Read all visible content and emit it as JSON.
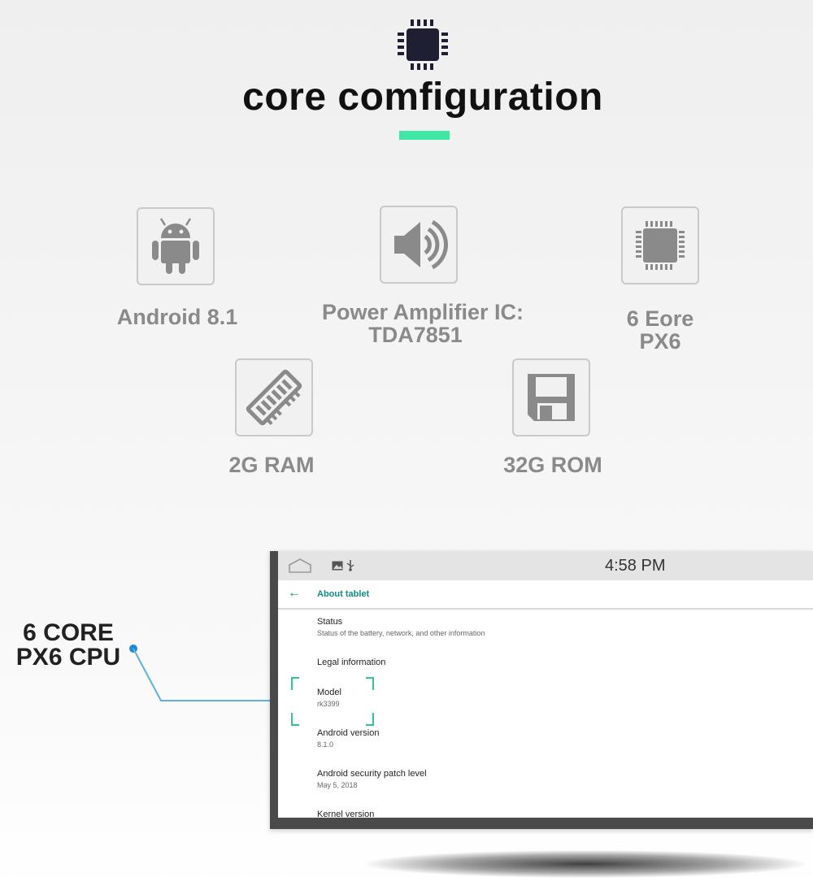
{
  "header": {
    "title": "core comfiguration"
  },
  "features": [
    {
      "icon": "android-icon",
      "label": "Android 8.1"
    },
    {
      "icon": "speaker-icon",
      "label_line1": "Power Amplifier IC:",
      "label_line2": "TDA7851"
    },
    {
      "icon": "chip-icon",
      "label_line1": "6 Eore",
      "label_line2": "PX6"
    },
    {
      "icon": "ram-icon",
      "label": "2G RAM"
    },
    {
      "icon": "floppy-disk-icon",
      "label": "32G ROM"
    }
  ],
  "callout": {
    "line1": "6 CORE",
    "line2": "PX6 CPU"
  },
  "tablet": {
    "status_bar": {
      "time": "4:58 PM"
    },
    "toolbar": {
      "title": "About tablet"
    },
    "items": [
      {
        "title": "Status",
        "subtitle": "Status of the battery, network, and other information"
      },
      {
        "title": "Legal information"
      },
      {
        "title": "Model",
        "subtitle": "rk3399"
      },
      {
        "title": "Android version",
        "subtitle": "8.1.0"
      },
      {
        "title": "Android security patch level",
        "subtitle": "May 5, 2018"
      },
      {
        "title": "Kernel version"
      }
    ]
  },
  "colors": {
    "accent": "#3fe7a5",
    "callout_line": "#1e8ad2",
    "settings_accent": "#128a80"
  }
}
